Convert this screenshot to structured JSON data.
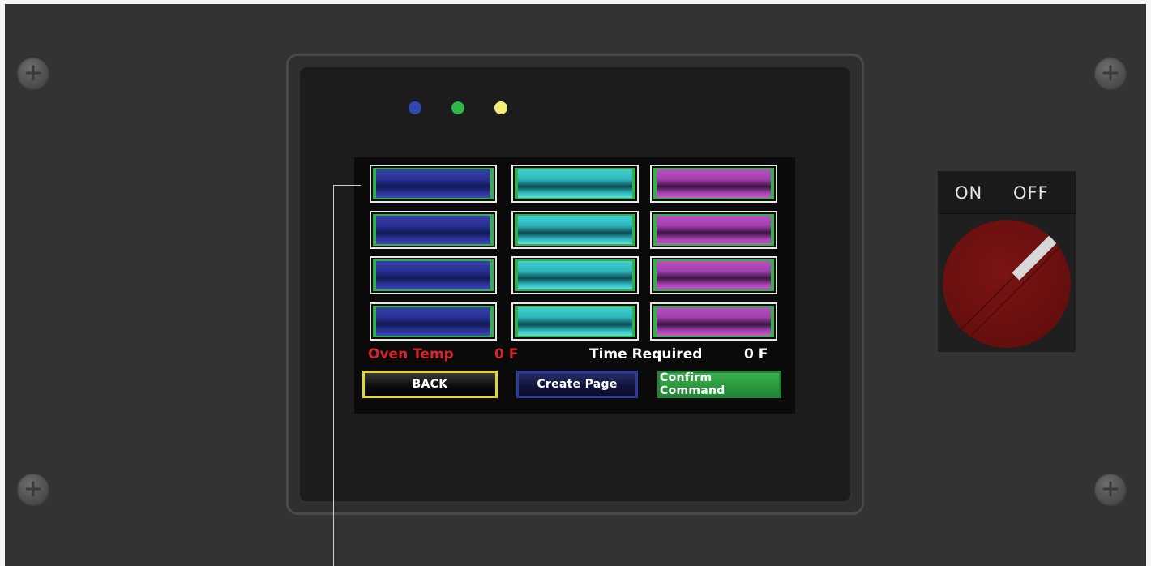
{
  "screen": {
    "oven_temp_label": "Oven Temp",
    "oven_temp_value": "0 F",
    "time_required_label": "Time Required",
    "time_required_value": "0 F",
    "buttons": {
      "back": "BACK",
      "create_page": "Create Page",
      "confirm_command": "Confirm Command"
    },
    "key_grid": {
      "rows": 4,
      "columns": [
        "blue",
        "cyan",
        "magenta"
      ]
    }
  },
  "indicator_leds": [
    "blue",
    "green",
    "yellow"
  ],
  "switch": {
    "on_label": "ON",
    "off_label": "OFF"
  },
  "colors": {
    "panel": "#333333",
    "bezel": "#1c1c1c",
    "screen": "#0a0a0a",
    "oven_temp_text": "#d4252c",
    "time_text": "#ffffff",
    "led_blue": "#3546b5",
    "led_green": "#2fb84a",
    "led_yellow": "#f2ec7a",
    "back_border": "#e3d52a",
    "create_border": "#2c3a9a",
    "confirm_fill": "#2c9a3f",
    "knob": "#6a1010"
  }
}
